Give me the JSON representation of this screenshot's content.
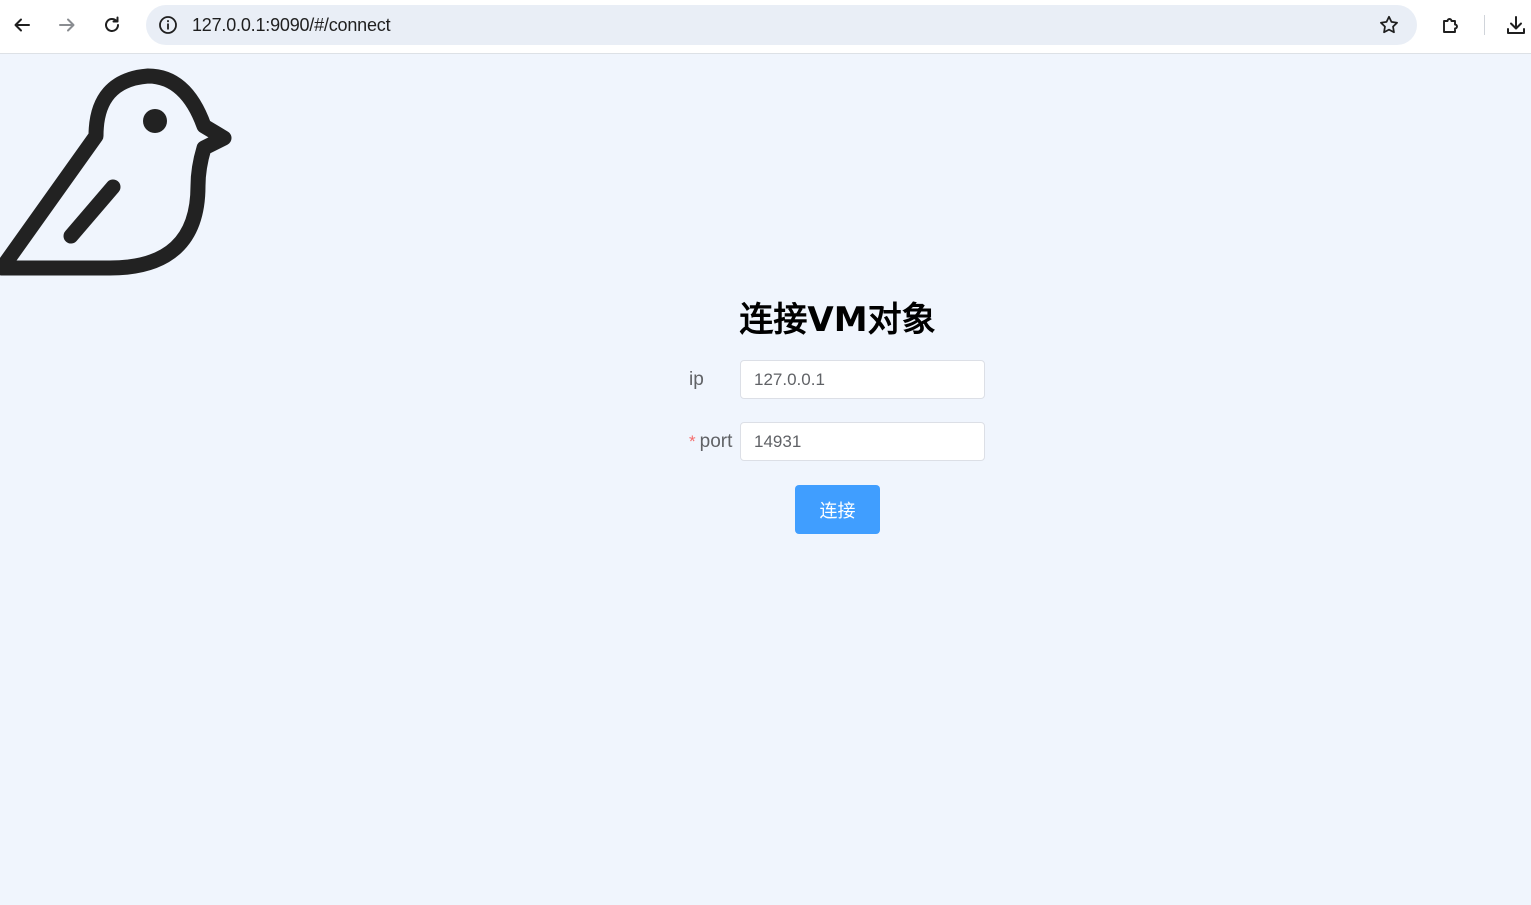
{
  "browser": {
    "url": "127.0.0.1:9090/#/connect",
    "icons": {
      "back": "arrow-left-icon",
      "forward": "arrow-right-icon",
      "reload": "reload-icon",
      "site_info": "info-icon",
      "bookmark": "star-icon",
      "extensions": "puzzle-icon",
      "downloads": "download-icon"
    }
  },
  "logo": {
    "icon": "bird-icon",
    "color": "#222222"
  },
  "form": {
    "title": "连接VM对象",
    "ip": {
      "label": "ip",
      "value": "127.0.0.1"
    },
    "port": {
      "label": "port",
      "required_mark": "*",
      "value": "14931"
    },
    "submit_label": "连接"
  },
  "colors": {
    "background": "#f0f5fd",
    "primary": "#409eff",
    "required": "#f56c6c",
    "label": "#606266"
  }
}
